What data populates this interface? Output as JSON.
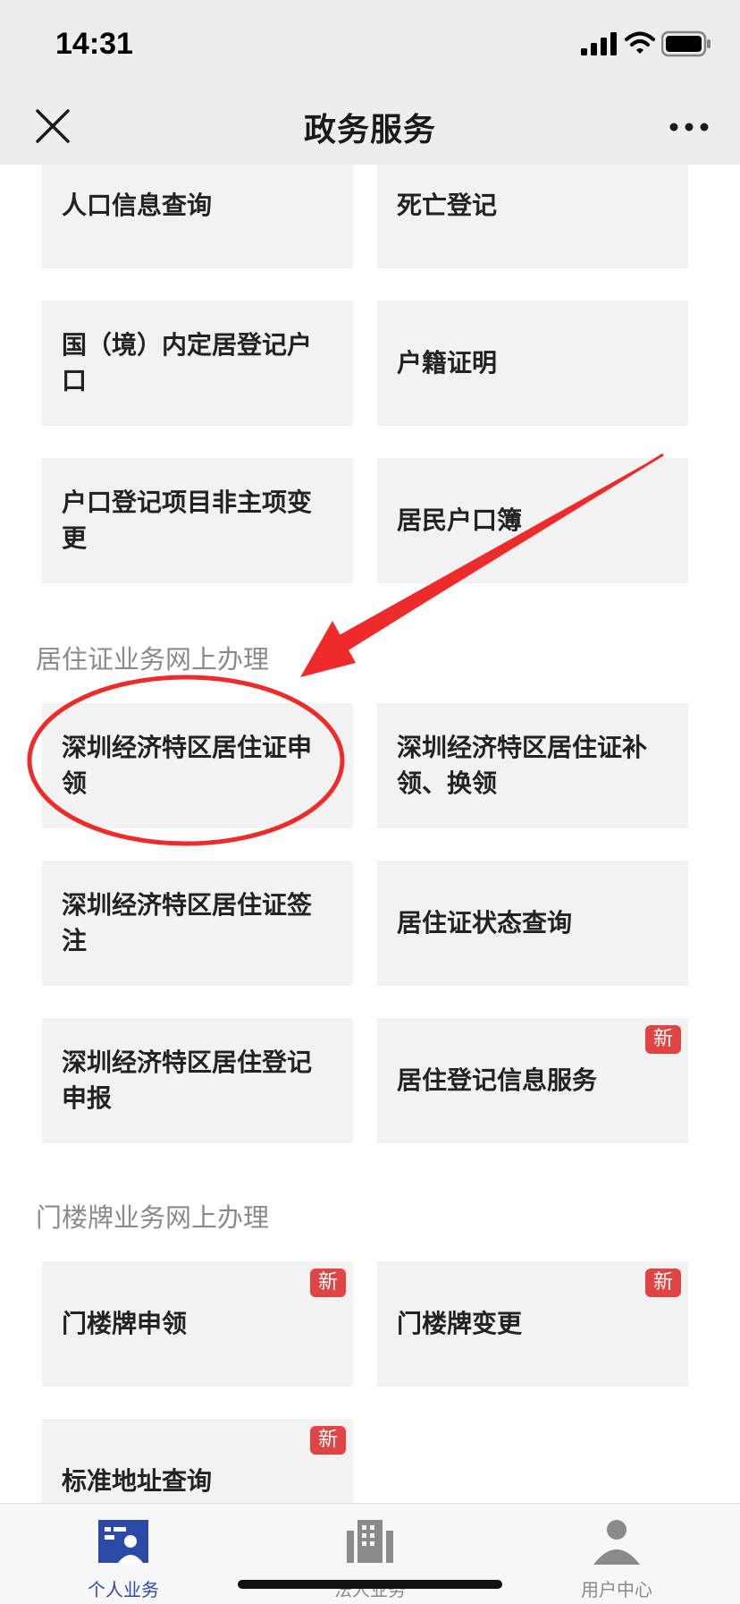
{
  "status_bar": {
    "time": "14:31"
  },
  "nav": {
    "title": "政务服务",
    "close_icon": "close-icon",
    "more_icon": "more-icon"
  },
  "top_tiles": [
    {
      "label": "人口信息查询"
    },
    {
      "label": "死亡登记"
    },
    {
      "label": "国（境）内定居登记户口"
    },
    {
      "label": "户籍证明"
    },
    {
      "label": "户口登记项目非主项变更"
    },
    {
      "label": "居民户口簿"
    }
  ],
  "residence_section": {
    "title": "居住证业务网上办理",
    "tiles": [
      {
        "label": "深圳经济特区居住证申领"
      },
      {
        "label": "深圳经济特区居住证补领、换领"
      },
      {
        "label": "深圳经济特区居住证签注"
      },
      {
        "label": "居住证状态查询"
      },
      {
        "label": "深圳经济特区居住登记申报"
      },
      {
        "label": "居住登记信息服务",
        "badge": "新"
      }
    ]
  },
  "doorplate_section": {
    "title": "门楼牌业务网上办理",
    "tiles": [
      {
        "label": "门楼牌申领",
        "badge": "新"
      },
      {
        "label": "门楼牌变更",
        "badge": "新"
      },
      {
        "label": "标准地址查询",
        "badge": "新"
      }
    ]
  },
  "tab_bar": {
    "tabs": [
      {
        "label": "个人业务",
        "icon": "personal-id-card-icon",
        "active": true
      },
      {
        "label": "法人业务",
        "icon": "building-icon",
        "active": false
      },
      {
        "label": "用户中心",
        "icon": "user-icon",
        "active": false
      }
    ]
  },
  "colors": {
    "accent_active_tab": "#2b4aa8",
    "badge_red": "#e04545",
    "annotation_red": "#ee2b2b",
    "header_bg": "#ededed",
    "tile_bg": "#f2f2f2"
  }
}
